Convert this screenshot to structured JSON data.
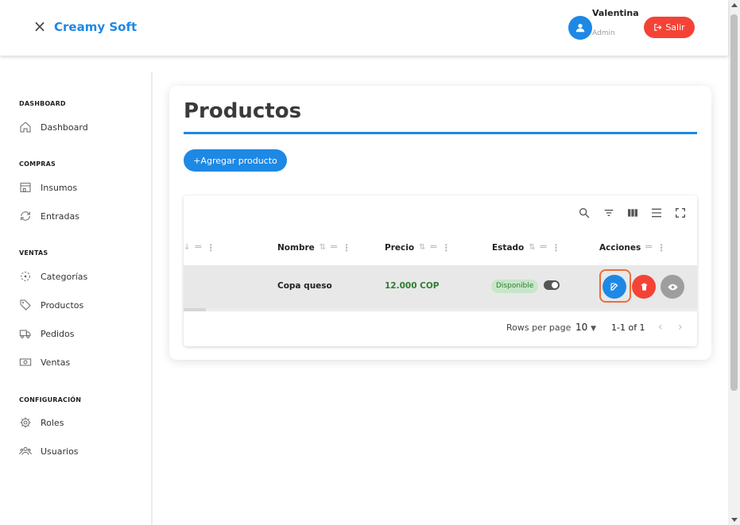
{
  "header": {
    "brand": "Creamy Soft",
    "close_icon": "×",
    "user_name": "Valentina",
    "user_role": "Admin",
    "logout_label": "Salir"
  },
  "sidebar": {
    "sections": [
      {
        "title": "DASHBOARD",
        "items": [
          {
            "label": "Dashboard",
            "icon": "home-icon"
          }
        ]
      },
      {
        "title": "COMPRAS",
        "items": [
          {
            "label": "Insumos",
            "icon": "store-icon"
          },
          {
            "label": "Entradas",
            "icon": "refresh-icon"
          }
        ]
      },
      {
        "title": "VENTAS",
        "items": [
          {
            "label": "Categorías",
            "icon": "categories-icon"
          },
          {
            "label": "Productos",
            "icon": "tag-icon"
          },
          {
            "label": "Pedidos",
            "icon": "truck-icon"
          },
          {
            "label": "Ventas",
            "icon": "cash-icon"
          }
        ]
      },
      {
        "title": "CONFIGURACIÓN",
        "items": [
          {
            "label": "Roles",
            "icon": "gear-icon"
          },
          {
            "label": "Usuarios",
            "icon": "users-icon"
          }
        ]
      }
    ]
  },
  "main": {
    "title": "Productos",
    "add_button": "+Agregar producto",
    "table": {
      "columns": [
        "Nombre",
        "Precio",
        "Estado",
        "Acciones"
      ],
      "rows": [
        {
          "nombre": "Copa queso",
          "precio": "12.000 COP",
          "estado": "Disponible"
        }
      ],
      "footer": {
        "rows_per_page_label": "Rows per page",
        "rows_per_page_value": "10",
        "range": "1-1 of 1"
      }
    }
  },
  "colors": {
    "accent": "#1e88e5",
    "danger": "#f44336",
    "success": "#2e7d32",
    "highlight": "#ef6c3a"
  }
}
